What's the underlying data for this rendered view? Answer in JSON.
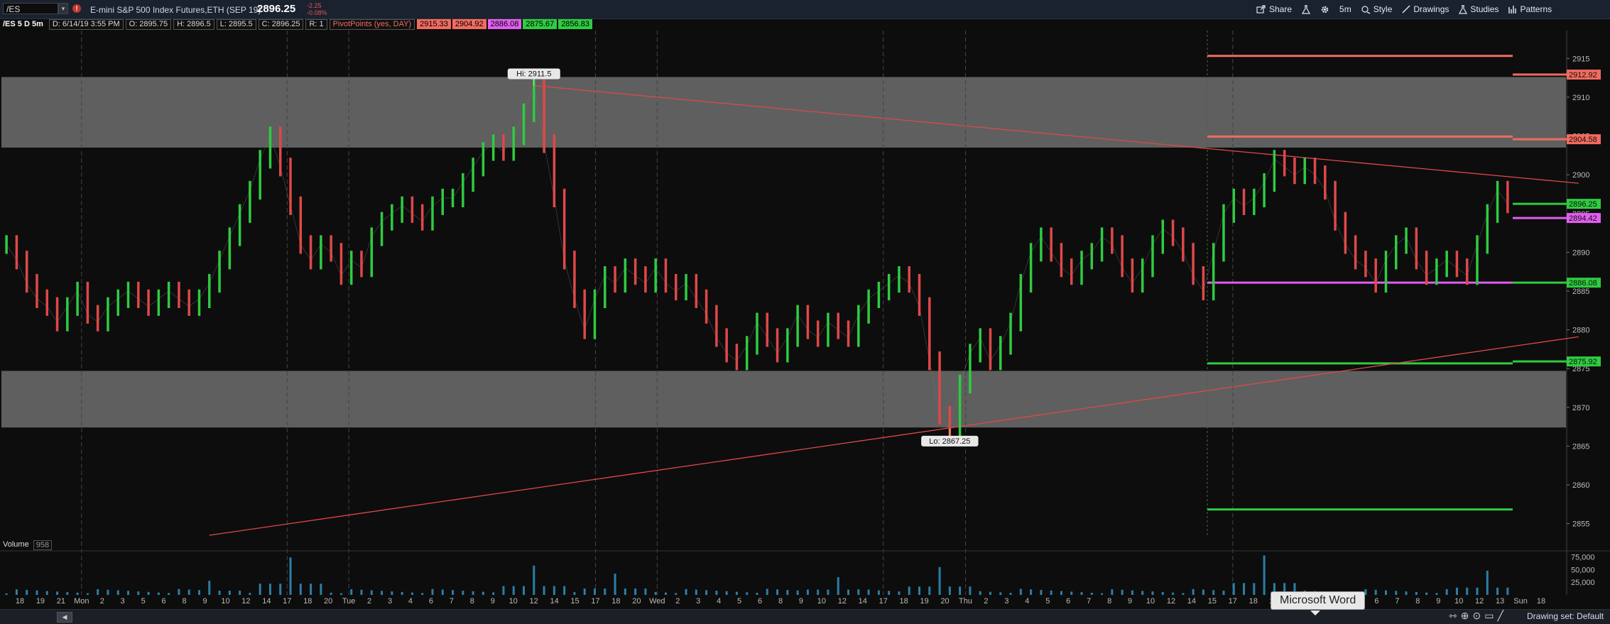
{
  "toolbar": {
    "symbol": "/ES",
    "symbol_drop": "▾",
    "alert_glyph": "!",
    "description": "E-mini S&P 500 Index Futures,ETH (SEP 19)",
    "last": "2896.25",
    "change": "-2.25",
    "change_pct": "-0.08%",
    "buttons": {
      "share": "Share",
      "timeframe": "5m",
      "style": "Style",
      "drawings": "Drawings",
      "studies": "Studies",
      "patterns": "Patterns"
    },
    "icons": [
      "share-icon",
      "flask-icon",
      "gear-icon",
      "style-icon",
      "drawings-icon",
      "studies-icon",
      "patterns-icon"
    ]
  },
  "info": {
    "chart_label": "/ES 5 D 5m",
    "date": "D: 6/14/19 3:55 PM",
    "open": "O: 2895.75",
    "high": "H: 2896.5",
    "low": "L: 2895.5",
    "close": "C: 2896.25",
    "range": "R: 1",
    "study": "PivotPoints (yes, DAY)",
    "pp_values": [
      "2915.33",
      "2904.92",
      "2886.08",
      "2875.67",
      "2856.83"
    ]
  },
  "volume": {
    "label": "Volume",
    "value": "958"
  },
  "bottom": {
    "drawing_set": "Drawing set: Default",
    "tooltip": "Microsoft Word",
    "scroll_glyph": "◀"
  },
  "colors": {
    "background": "#0d0d0d",
    "zone": "#6e6e6e",
    "resistance": "#f26b5f",
    "pivot": "#e05ef0",
    "support": "#2ecc40",
    "trendline": "#e04848",
    "volume": "#2a7fa8",
    "up_candle": "#2ecc40",
    "down_candle": "#e04848"
  },
  "chart_data": {
    "type": "line",
    "title": "/ES 5 D 5m",
    "ylim": [
      2853.5,
      2918.6
    ],
    "y_ticks": [
      2855,
      2860,
      2865,
      2870,
      2875,
      2880,
      2885,
      2890,
      2895,
      2900,
      2905,
      2910,
      2915
    ],
    "x_ticks": [
      "18",
      "19",
      "21",
      "Mon",
      "2",
      "3",
      "5",
      "6",
      "8",
      "9",
      "10",
      "12",
      "14",
      "17",
      "18",
      "20",
      "Tue",
      "2",
      "3",
      "4",
      "6",
      "7",
      "8",
      "9",
      "10",
      "12",
      "14",
      "15",
      "17",
      "18",
      "20",
      "Wed",
      "2",
      "3",
      "4",
      "5",
      "6",
      "8",
      "9",
      "10",
      "12",
      "14",
      "17",
      "18",
      "19",
      "20",
      "Thu",
      "2",
      "3",
      "4",
      "5",
      "6",
      "7",
      "8",
      "9",
      "10",
      "12",
      "14",
      "15",
      "17",
      "18",
      "20",
      "2",
      "3",
      "4",
      "5",
      "6",
      "7",
      "8",
      "9",
      "10",
      "12",
      "13",
      "Sun",
      "18"
    ],
    "day_separators": [
      "Mon",
      "Tue",
      "Wed",
      "Thu",
      "Fri"
    ],
    "series": [
      {
        "name": "/ES",
        "values": [
          2891,
          2889,
          2886,
          2884,
          2883,
          2881,
          2883,
          2885,
          2882,
          2881,
          2883,
          2884,
          2885,
          2884,
          2883,
          2884,
          2885,
          2884,
          2883,
          2884,
          2886,
          2889,
          2892,
          2895,
          2898,
          2902,
          2905,
          2901,
          2896,
          2891,
          2889,
          2891,
          2890,
          2887,
          2889,
          2888,
          2892,
          2894,
          2895,
          2896,
          2895,
          2894,
          2896,
          2897,
          2897,
          2899,
          2901,
          2903,
          2904,
          2903,
          2905,
          2908,
          2911.5,
          2904,
          2897,
          2889,
          2884,
          2880,
          2884,
          2887,
          2886,
          2888,
          2887,
          2886,
          2888,
          2886,
          2885,
          2886,
          2884,
          2882,
          2879,
          2877,
          2876,
          2878,
          2881,
          2879,
          2877,
          2879,
          2882,
          2880,
          2879,
          2881,
          2880,
          2879,
          2882,
          2884,
          2885,
          2886,
          2887,
          2886,
          2883,
          2876,
          2869,
          2867.25,
          2873,
          2877,
          2879,
          2876,
          2878,
          2881,
          2886,
          2890,
          2892,
          2890,
          2888,
          2887,
          2889,
          2890,
          2892,
          2891,
          2888,
          2886,
          2888,
          2891,
          2893,
          2892,
          2890,
          2887,
          2885,
          2890,
          2895,
          2897,
          2896,
          2897,
          2899,
          2902,
          2901,
          2900,
          2901,
          2900,
          2898,
          2894,
          2891,
          2889,
          2888,
          2886,
          2889,
          2891,
          2892,
          2889,
          2887,
          2888,
          2889,
          2888,
          2887,
          2891,
          2895,
          2898,
          2896.25
        ]
      }
    ],
    "hi_label": "Hi: 2911.5",
    "lo_label": "Lo: 2867.25",
    "zones": [
      {
        "from": 2903.5,
        "to": 2912.6
      },
      {
        "from": 2867.4,
        "to": 2874.7
      }
    ],
    "pivot_lines": [
      {
        "value": 2915.33,
        "kind": "r2"
      },
      {
        "value": 2904.92,
        "kind": "r1"
      },
      {
        "value": 2886.08,
        "kind": "pp"
      },
      {
        "value": 2875.67,
        "kind": "s1"
      },
      {
        "value": 2856.83,
        "kind": "s2"
      }
    ],
    "price_labels": [
      {
        "value": 2912.92,
        "text": "2912.92",
        "kind": "r"
      },
      {
        "value": 2904.58,
        "text": "2904.58",
        "kind": "r"
      },
      {
        "value": 2896.25,
        "text": "2896.25",
        "kind": "s"
      },
      {
        "value": 2894.42,
        "text": "2894.42",
        "kind": "p"
      },
      {
        "value": 2886.08,
        "text": "2886.08",
        "kind": "s"
      },
      {
        "value": 2875.92,
        "text": "2875.92",
        "kind": "s"
      }
    ],
    "trendlines": [
      {
        "from": [
          52,
          2911.5
        ],
        "to": [
          155,
          2898.9
        ]
      },
      {
        "from": [
          20,
          2853.5
        ],
        "to": [
          155,
          2879.1
        ]
      }
    ],
    "volume_axis": [
      "75,000",
      "50,000",
      "25,000"
    ],
    "volume_max": 80000,
    "volume_spikes": [
      {
        "at": 20,
        "value": 28000
      },
      {
        "at": 28,
        "value": 74000
      },
      {
        "at": 52,
        "value": 58000
      },
      {
        "at": 60,
        "value": 42000
      },
      {
        "at": 82,
        "value": 35000
      },
      {
        "at": 92,
        "value": 55000
      },
      {
        "at": 124,
        "value": 78000
      },
      {
        "at": 146,
        "value": 48000
      },
      {
        "at": 152,
        "value": 52000
      }
    ]
  }
}
